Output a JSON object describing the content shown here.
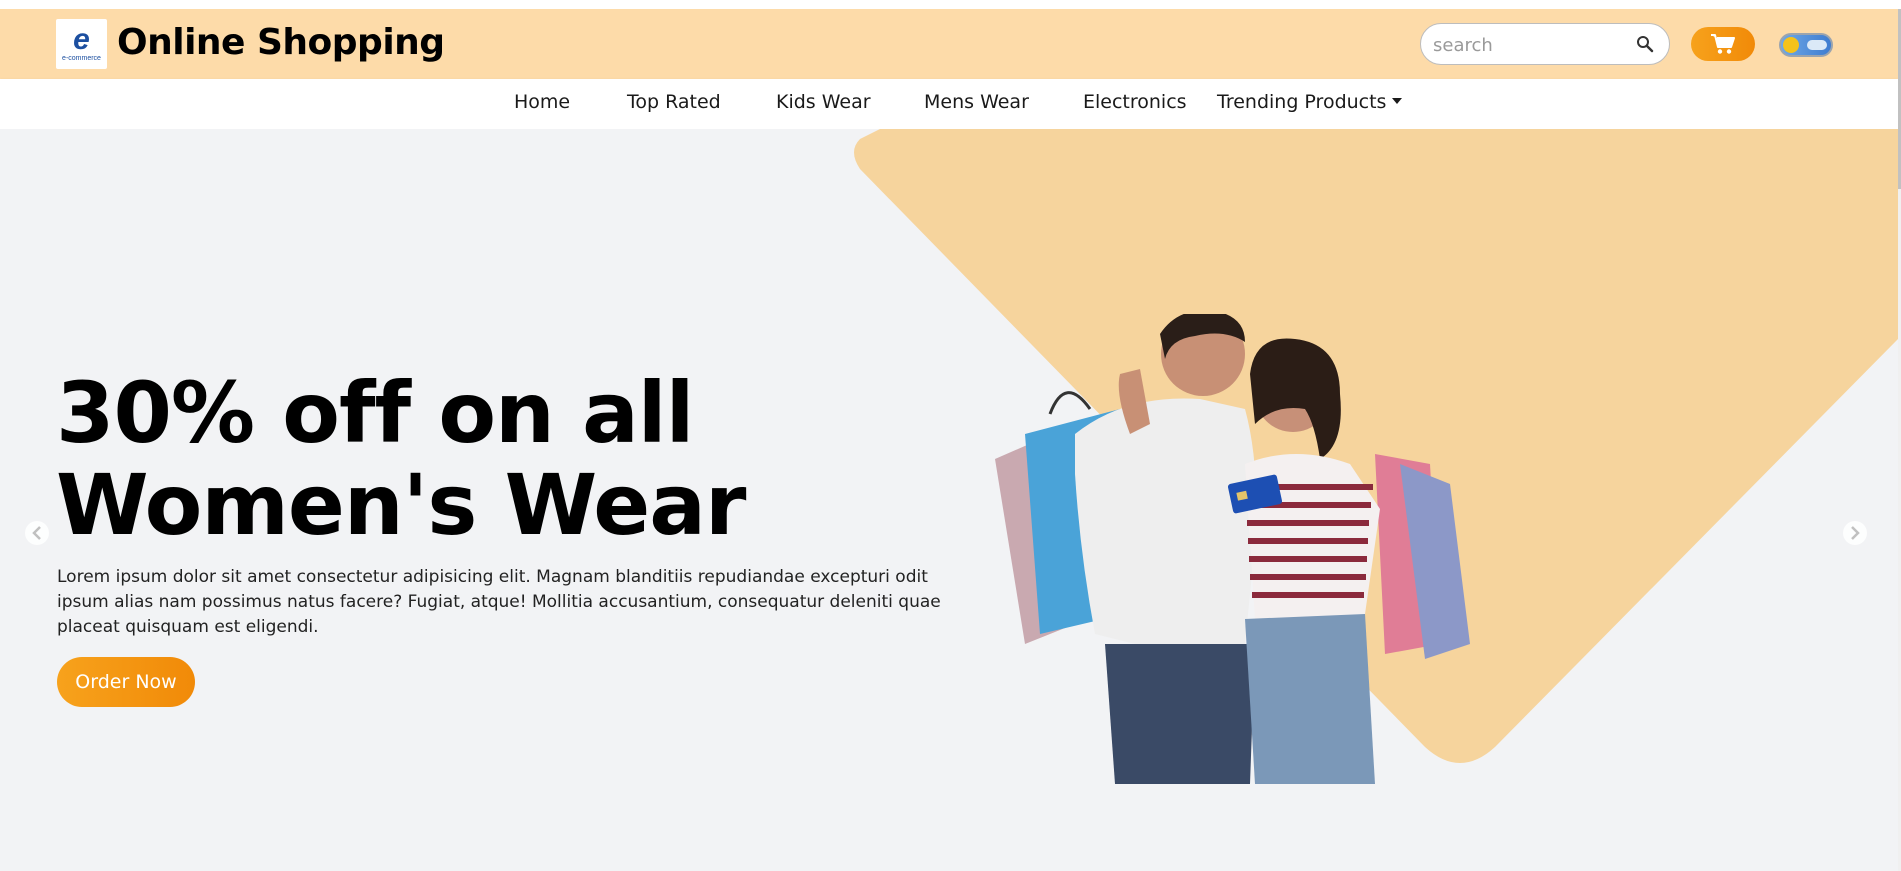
{
  "header": {
    "logo": {
      "letter": "e",
      "caption": "e-commerce"
    },
    "brand": "Online Shopping",
    "search": {
      "placeholder": "search",
      "value": ""
    },
    "icons": {
      "search": "search-icon",
      "cart": "cart-icon",
      "theme_toggle": "theme-toggle"
    }
  },
  "nav": {
    "items": [
      {
        "label": "Home"
      },
      {
        "label": "Top Rated"
      },
      {
        "label": "Kids Wear"
      },
      {
        "label": "Mens Wear"
      },
      {
        "label": "Electronics"
      },
      {
        "label": "Trending Products",
        "dropdown": true
      }
    ]
  },
  "hero": {
    "headline_line1": "30% off on all",
    "headline_line2": "Women's Wear",
    "description": "Lorem ipsum dolor sit amet consectetur adipisicing elit. Magnam blanditiis repudiandae excepturi odit ipsum alias nam possimus natus facere? Fugiat, atque! Mollitia accusantium, consequatur deleniti quae placeat quisquam est eligendi.",
    "cta": "Order Now",
    "carousel": {
      "prev": "chevron-left-icon",
      "next": "chevron-right-icon"
    }
  },
  "colors": {
    "header_bg": "#fddba9",
    "accent": "#f7a21c",
    "hero_shape": "#f6d49d",
    "hero_bg": "#f2f3f5"
  }
}
